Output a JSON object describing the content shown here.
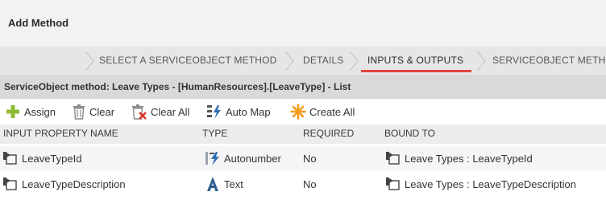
{
  "dialog": {
    "title": "Add Method"
  },
  "wizard": {
    "steps": [
      {
        "label": "SELECT A SERVICEOBJECT METHOD"
      },
      {
        "label": "DETAILS"
      },
      {
        "label": "INPUTS & OUTPUTS",
        "active": true
      },
      {
        "label": "SERVICEOBJECT METH"
      }
    ],
    "accent_color": "#e0443c"
  },
  "method_header": "ServiceObject method: Leave Types - [HumanResources].[LeaveType] - List",
  "toolbar": {
    "assign": "Assign",
    "clear": "Clear",
    "clear_all": "Clear All",
    "auto_map": "Auto Map",
    "create_all": "Create All"
  },
  "table": {
    "columns": [
      "INPUT PROPERTY NAME",
      "TYPE",
      "REQUIRED",
      "BOUND TO"
    ],
    "rows": [
      {
        "name": "LeaveTypeId",
        "type": "Autonumber",
        "type_icon": "autonumber-icon",
        "required": "No",
        "bound_to": "Leave Types : LeaveTypeId"
      },
      {
        "name": "LeaveTypeDescription",
        "type": "Text",
        "type_icon": "text-type-icon",
        "required": "No",
        "bound_to": "Leave Types : LeaveTypeDescription"
      }
    ]
  }
}
